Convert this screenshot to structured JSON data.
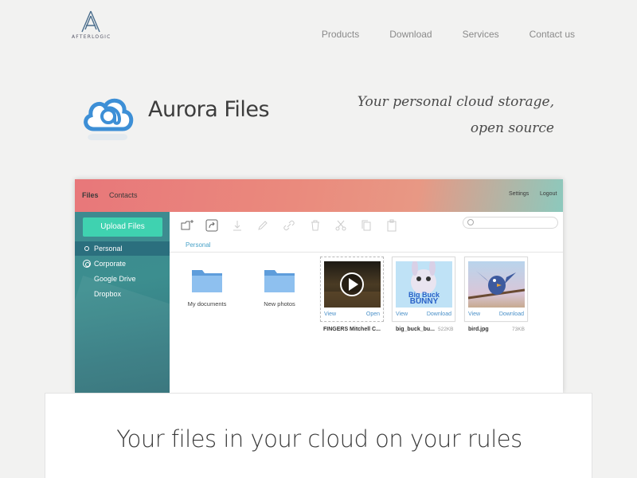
{
  "brand": {
    "logo_text": "AFTERLOGIC"
  },
  "nav": {
    "items": [
      "Products",
      "Download",
      "Services",
      "Contact us"
    ]
  },
  "hero": {
    "title": "Aurora Files",
    "tagline_line1": "Your personal cloud storage,",
    "tagline_line2": "open source"
  },
  "app": {
    "tabs": [
      "Files",
      "Contacts"
    ],
    "header_links": [
      "Settings",
      "Logout"
    ],
    "upload_label": "Upload Files",
    "sidebar": [
      "Personal",
      "Corporate",
      "Google Drive",
      "Dropbox"
    ],
    "breadcrumb": "Personal",
    "folders": [
      "My documents",
      "New photos"
    ],
    "files": [
      {
        "name": "FINGERS Mitchell C...",
        "size": "",
        "left_action": "View",
        "right_action": "Open"
      },
      {
        "name": "big_buck_bu...",
        "size": "522KB",
        "left_action": "View",
        "right_action": "Download"
      },
      {
        "name": "bird.jpg",
        "size": "73KB",
        "left_action": "View",
        "right_action": "Download"
      }
    ],
    "thumb_text": {
      "big": "Big Buck",
      "bunny": "BUNNY"
    }
  },
  "bottom": {
    "title": "Your files in your cloud on your rules"
  },
  "colors": {
    "accent": "#3fd2b0",
    "sidebar": "#3c8e8f",
    "link": "#4a90c8"
  }
}
